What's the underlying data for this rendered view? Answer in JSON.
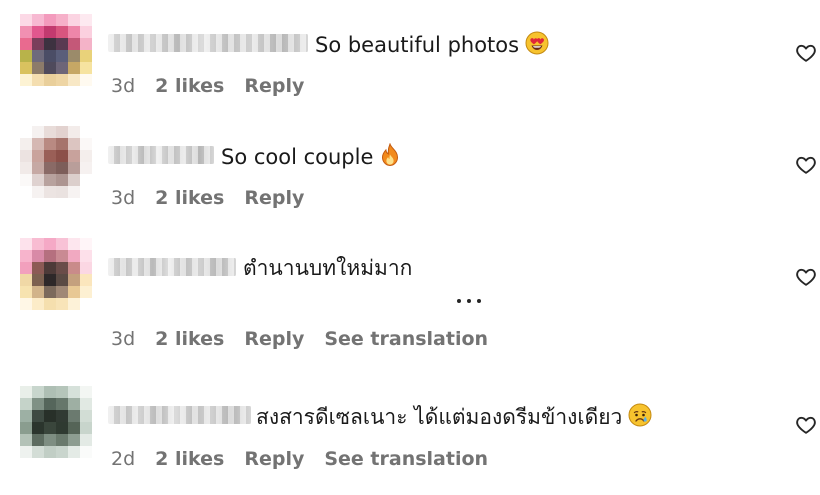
{
  "comments": [
    {
      "text": "So beautiful photos",
      "emoji": "heart-eyes-emoji",
      "time": "3d",
      "likes": "2 likes",
      "reply": "Reply"
    },
    {
      "text": "So cool couple",
      "emoji": "fire-emoji",
      "time": "3d",
      "likes": "2 likes",
      "reply": "Reply"
    },
    {
      "text": "ตำนานบทใหม่มาก",
      "time": "3d",
      "likes": "2 likes",
      "reply": "Reply",
      "translation": "See translation"
    },
    {
      "text": "สงสารดีเซลเนาะ ได้แต่มองดรีมข้างเดียว",
      "emoji": "sad-face-emoji",
      "time": "2d",
      "likes": "2 likes",
      "reply": "Reply",
      "translation": "See translation"
    }
  ],
  "colors": {
    "meta_text": "#737373",
    "comment_text": "#1a1a1a",
    "background": "#ffffff"
  }
}
